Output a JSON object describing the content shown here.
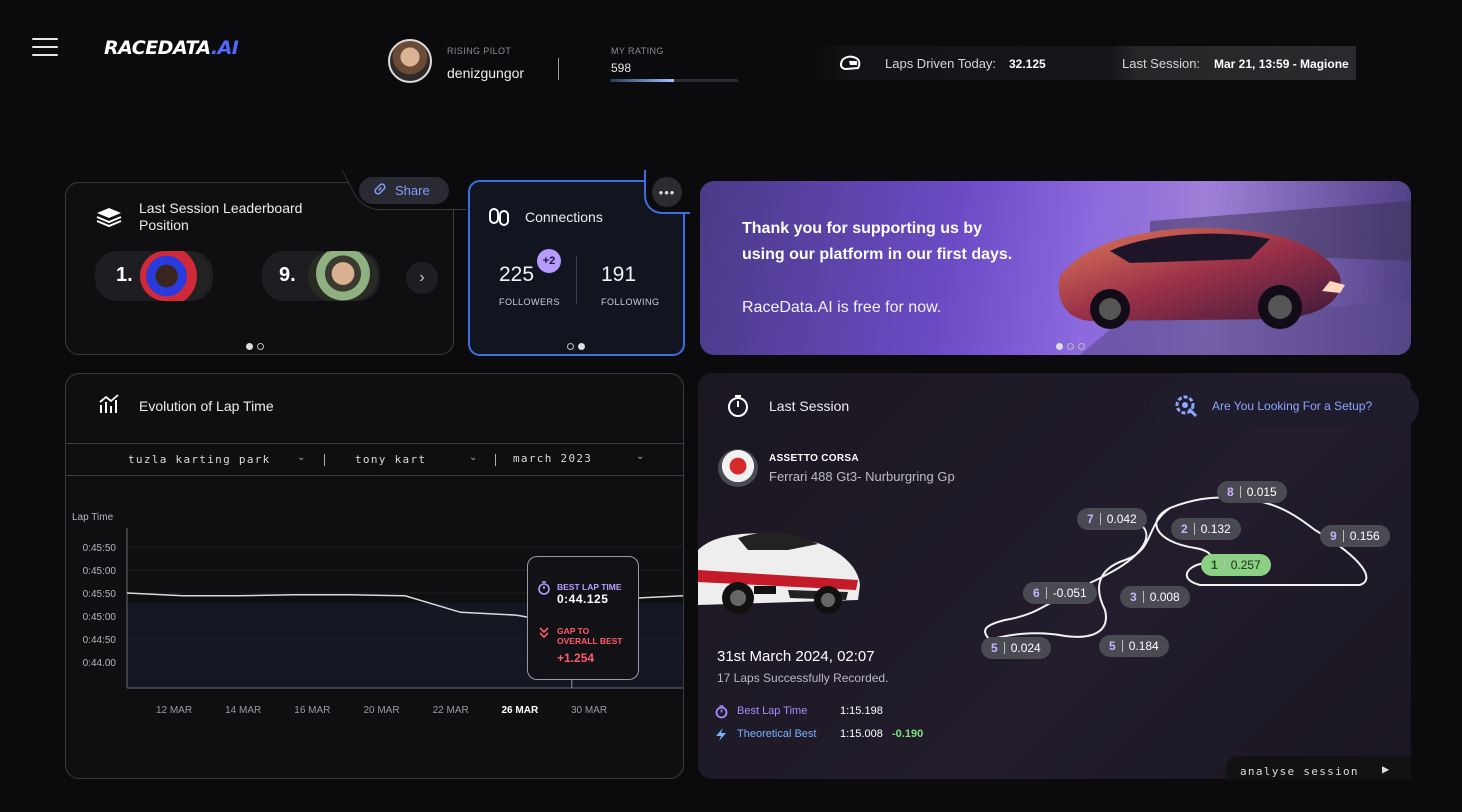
{
  "header": {
    "logo_main": "RACEDATA",
    "logo_ai": ".AI",
    "pilot_rank_label": "RISING PILOT",
    "username": "denizgungor",
    "rating_label": "MY RATING",
    "rating_value": "598",
    "rating_progress": 0.5,
    "laps_label": "Laps Driven Today:",
    "laps_value": "32.125",
    "last_session_label": "Last Session:",
    "last_session_value": "Mar 21, 13:59 - Magione"
  },
  "leaderboard": {
    "title": "Last Session Leaderboard Position",
    "share_label": "Share",
    "entries": [
      {
        "rank": "1."
      },
      {
        "rank": "9."
      }
    ]
  },
  "connections": {
    "title": "Connections",
    "followers": "225",
    "followers_label": "FOLLOWERS",
    "followers_badge": "+2",
    "following": "191",
    "following_label": "FOLLOWING"
  },
  "banner": {
    "line1": "Thank you for supporting us by",
    "line2": "using our platform in our first days.",
    "line3": "RaceData.AI is free for now."
  },
  "lap_chart": {
    "title": "Evolution of Lap Time",
    "filters": [
      "tuzla karting park",
      "tony kart",
      "march 2023"
    ],
    "y_title": "Lap Time",
    "tooltip": {
      "best_label": "BEST LAP TIME",
      "best_value": "0:44.125",
      "gap_label_1": "GAP TO",
      "gap_label_2": "OVERALL BEST",
      "gap_value": "+1.254"
    }
  },
  "chart_data": {
    "type": "line",
    "ylabel": "Lap Time",
    "yticks": [
      "0:45:50",
      "0:45:00",
      "0:45:50",
      "0:45:00",
      "0:44:50",
      "0:44.00"
    ],
    "x_labels": [
      "12 MAR",
      "14 MAR",
      "16 MAR",
      "20 MAR",
      "22 MAR",
      "26 MAR",
      "30 MAR"
    ],
    "highlight": "26 MAR",
    "series": [
      {
        "values": [
          44.95,
          44.9,
          44.9,
          44.92,
          44.92,
          44.9,
          44.6,
          44.55,
          44.37,
          44.85,
          44.9
        ]
      }
    ]
  },
  "last_session": {
    "title": "Last Session",
    "setup_label": "Are You Looking For a Setup?",
    "game": "ASSETTO CORSA",
    "car_track": "Ferrari 488 Gt3- Nurburgring Gp",
    "date": "31st March 2024, 02:07",
    "laps": "17 Laps Successfully Recorded.",
    "best_label": "Best Lap Time",
    "best_value": "1:15.198",
    "theo_label": "Theoretical Best",
    "theo_value": "1:15.008",
    "theo_delta": "-0.190",
    "analyse_label": "analyse session",
    "segments": [
      {
        "n": "8",
        "v": "0.015"
      },
      {
        "n": "7",
        "v": "0.042"
      },
      {
        "n": "2",
        "v": "0.132"
      },
      {
        "n": "9",
        "v": "0.156"
      },
      {
        "n": "1",
        "v": "0.257"
      },
      {
        "n": "6",
        "v": "-0.051"
      },
      {
        "n": "3",
        "v": "0.008"
      },
      {
        "n": "5",
        "v": "0.024"
      },
      {
        "n": "5",
        "v": "0.184"
      }
    ]
  }
}
